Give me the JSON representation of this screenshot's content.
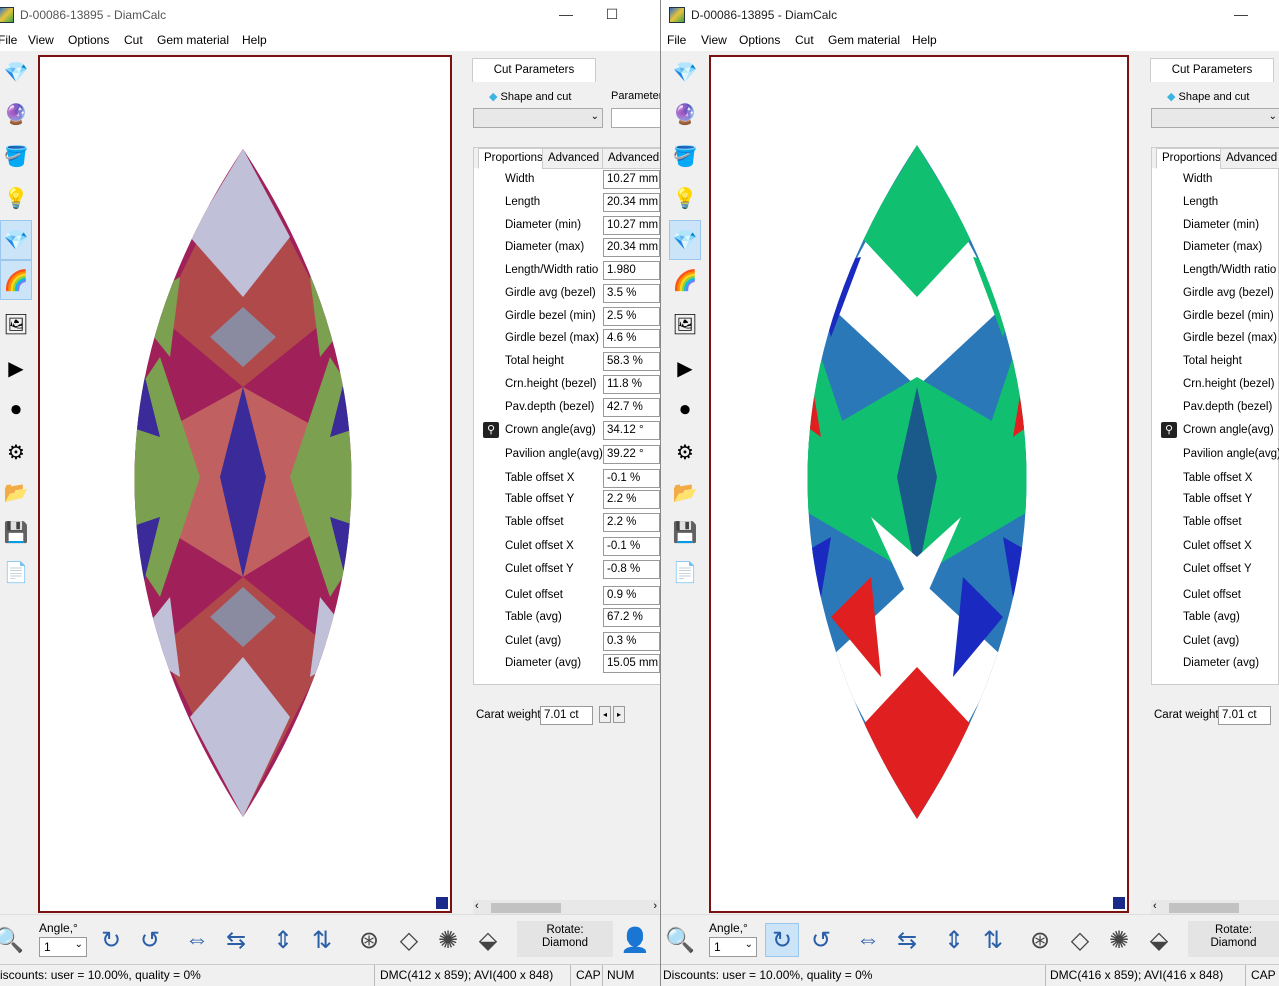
{
  "windows": [
    {
      "title": "D-00086-13895 - DiamCalc",
      "menu": [
        "File",
        "View",
        "Options",
        "Cut",
        "Gem material",
        "Help"
      ],
      "panel_tab": "Cut Parameters",
      "shape_label": "Shape and cut",
      "param_label": "Parameter",
      "subtabs": [
        "Proportions",
        "Advanced",
        "Advanced"
      ],
      "properties": [
        {
          "label": "Width",
          "value": "10.27 mm"
        },
        {
          "label": "Length",
          "value": "20.34 mm"
        },
        {
          "label": "Diameter (min)",
          "value": "10.27 mm"
        },
        {
          "label": "Diameter (max)",
          "value": "20.34 mm"
        },
        {
          "label": "Length/Width ratio",
          "value": "1.980"
        },
        {
          "label": "Girdle avg (bezel)",
          "value": "3.5 %"
        },
        {
          "label": "Girdle bezel (min)",
          "value": "2.5 %"
        },
        {
          "label": "Girdle bezel (max)",
          "value": "4.6 %"
        },
        {
          "label": "Total height",
          "value": "58.3 %"
        },
        {
          "label": "Crn.height (bezel)",
          "value": "11.8 %"
        },
        {
          "label": "Pav.depth (bezel)",
          "value": "42.7 %"
        },
        {
          "label": "Crown angle(avg)",
          "value": "34.12 °"
        },
        {
          "label": "Pavilion angle(avg)",
          "value": "39.22 °"
        },
        {
          "label": "Table offset X",
          "value": "-0.1 %"
        },
        {
          "label": "Table offset Y",
          "value": "2.2 %"
        },
        {
          "label": "Table offset",
          "value": "2.2 %"
        },
        {
          "label": "Culet offset X",
          "value": "-0.1 %"
        },
        {
          "label": "Culet offset Y",
          "value": "-0.8 %"
        },
        {
          "label": "Culet offset",
          "value": "0.9 %"
        },
        {
          "label": "Table (avg)",
          "value": "67.2 %"
        },
        {
          "label": "Culet (avg)",
          "value": "0.3 %"
        },
        {
          "label": "Diameter (avg)",
          "value": "15.05 mm"
        }
      ],
      "carat_label": "Carat weight",
      "carat_value": "7.01 ct",
      "angle_label": "Angle,°",
      "angle_value": "1",
      "rotate_label": "Rotate:",
      "rotate_value": "Diamond",
      "status": {
        "discounts": "iscounts: user = 10.00%, quality = 0%",
        "dims": "DMC(412 x 859); AVI(400 x 848)",
        "cap": "CAP",
        "num": "NUM"
      }
    },
    {
      "title": "D-00086-13895 - DiamCalc",
      "menu": [
        "File",
        "View",
        "Options",
        "Cut",
        "Gem material",
        "Help"
      ],
      "panel_tab": "Cut Parameters",
      "shape_label": "Shape and cut",
      "subtabs": [
        "Proportions",
        "Advanced"
      ],
      "properties": [
        {
          "label": "Width"
        },
        {
          "label": "Length"
        },
        {
          "label": "Diameter (min)"
        },
        {
          "label": "Diameter (max)"
        },
        {
          "label": "Length/Width ratio"
        },
        {
          "label": "Girdle avg (bezel)"
        },
        {
          "label": "Girdle bezel (min)"
        },
        {
          "label": "Girdle bezel (max)"
        },
        {
          "label": "Total height"
        },
        {
          "label": "Crn.height (bezel)"
        },
        {
          "label": "Pav.depth (bezel)"
        },
        {
          "label": "Crown angle(avg)"
        },
        {
          "label": "Pavilion angle(avg)"
        },
        {
          "label": "Table offset X"
        },
        {
          "label": "Table offset Y"
        },
        {
          "label": "Table offset"
        },
        {
          "label": "Culet offset X"
        },
        {
          "label": "Culet offset Y"
        },
        {
          "label": "Culet offset"
        },
        {
          "label": "Table (avg)"
        },
        {
          "label": "Culet (avg)"
        },
        {
          "label": "Diameter (avg)"
        }
      ],
      "carat_label": "Carat weight",
      "carat_value": "7.01 ct",
      "angle_label": "Angle,°",
      "angle_value": "1",
      "rotate_label": "Rotate:",
      "rotate_value": "Diamond",
      "status": {
        "discounts": "Discounts: user = 10.00%, quality = 0%",
        "dims": "DMC(416 x 859); AVI(416 x 848)",
        "cap": "CAP"
      }
    }
  ],
  "colors": {
    "frame": "#7a1010",
    "gemA": [
      "#a0205a",
      "#7aa050",
      "#b04a4a",
      "#3a2a9a",
      "#c0c0d8"
    ],
    "gemB": [
      "#10c070",
      "#e02020",
      "#1a2ac0",
      "#2a78b8",
      "#ffffff"
    ]
  }
}
